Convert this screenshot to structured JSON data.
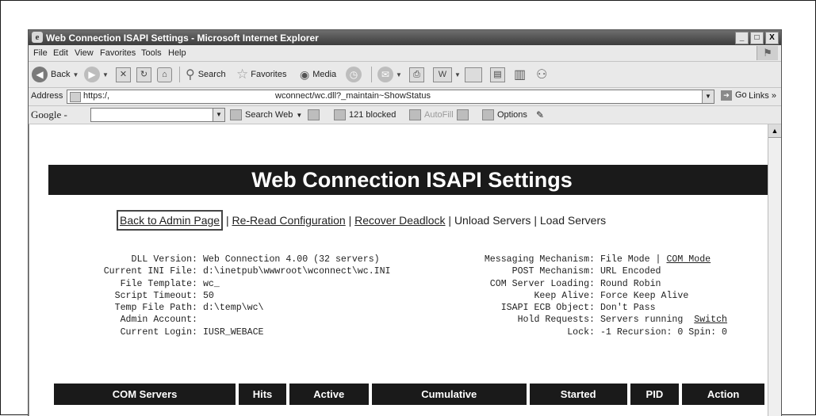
{
  "window": {
    "title": "Web Connection ISAPI Settings - Microsoft Internet Explorer",
    "buttons": [
      "_",
      "□",
      "X"
    ]
  },
  "menu": [
    "File",
    "Edit",
    "View",
    "Favorites",
    "Tools",
    "Help"
  ],
  "toolbar": {
    "back": "Back",
    "search": "Search",
    "favorites": "Favorites",
    "media": "Media"
  },
  "address": {
    "label": "Address",
    "protocol": "https:/,",
    "path": "wconnect/wc.dll?_maintain~ShowStatus",
    "go": "Go",
    "links": "Links"
  },
  "google": {
    "logo": "Google -",
    "search_web": "Search Web",
    "blocked": "121 blocked",
    "autofill": "AutoFill",
    "options": "Options"
  },
  "page": {
    "title": "Web Connection ISAPI Settings",
    "actions": {
      "back_admin": "Back to Admin Page",
      "reread": "Re-Read Configuration",
      "recover": "Recover Deadlock",
      "unload": "Unload Servers",
      "load": "Load Servers",
      "sep": "|"
    },
    "info_left": [
      {
        "k": "DLL Version:",
        "v": "Web Connection 4.00 (32 servers)"
      },
      {
        "k": "Current INI File:",
        "v": "d:\\inetpub\\wwwroot\\wconnect\\wc.INI"
      },
      {
        "k": "File Template:",
        "v": "wc_"
      },
      {
        "k": "Script Timeout:",
        "v": "50"
      },
      {
        "k": "Temp File Path:",
        "v": "d:\\temp\\wc\\"
      },
      {
        "k": "Admin Account:",
        "v": ""
      },
      {
        "k": "Current Login:",
        "v": "IUSR_WEBACE"
      }
    ],
    "info_right": {
      "messaging": {
        "k": "Messaging Mechanism:",
        "v": "File Mode |",
        "link": "COM Mode"
      },
      "post": {
        "k": "POST Mechanism:",
        "v": "URL Encoded"
      },
      "com_loading": {
        "k": "COM Server Loading:",
        "v": "Round Robin"
      },
      "keep_alive": {
        "k": "Keep Alive:",
        "v": "Force Keep Alive"
      },
      "ecb": {
        "k": "ISAPI ECB Object:",
        "v": "Don't Pass"
      },
      "hold": {
        "k": "Hold Requests:",
        "v": "Servers running",
        "link": "Switch"
      },
      "lock": {
        "k": "Lock:",
        "v": "-1 Recursion: 0 Spin: 0"
      }
    },
    "table_headers": [
      "COM Servers",
      "Hits",
      "Active",
      "Cumulative",
      "Started",
      "PID",
      "Action"
    ]
  }
}
